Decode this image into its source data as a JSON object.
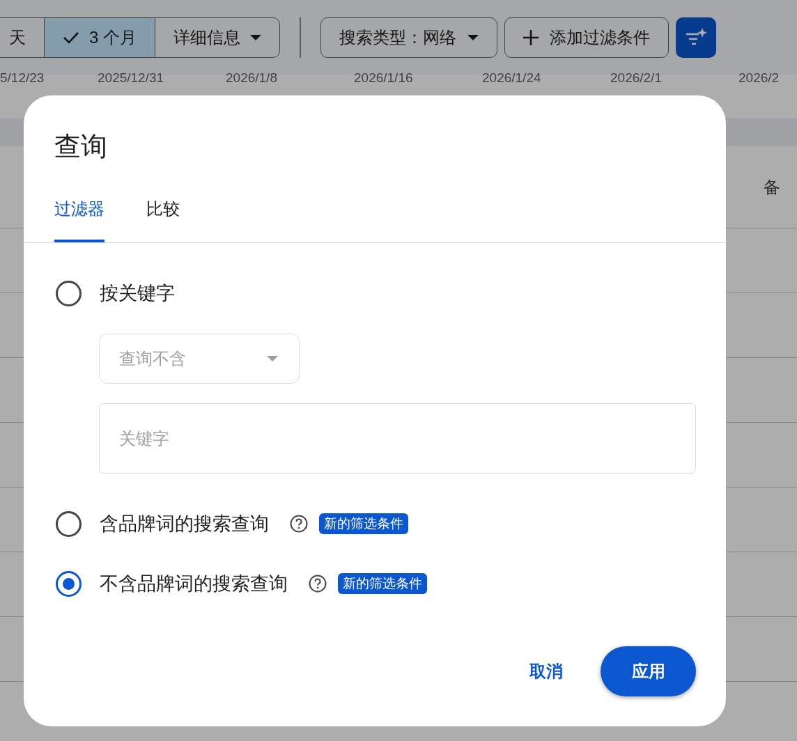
{
  "toolbar": {
    "segments": [
      {
        "kind": "option",
        "label": "天",
        "selected": false
      },
      {
        "kind": "option",
        "label": "3 个月",
        "selected": true
      },
      {
        "kind": "menu",
        "label": "详细信息",
        "selected": false
      }
    ],
    "chips": [
      {
        "kind": "menu",
        "label": "搜索类型：网络"
      },
      {
        "kind": "add",
        "label": "添加过滤条件"
      }
    ]
  },
  "date_axis": [
    "5/12/23",
    "2025/12/31",
    "2026/1/8",
    "2026/1/16",
    "2026/1/24",
    "2026/2/1",
    "2026/2"
  ],
  "table": {
    "header_cell": "备"
  },
  "dialog": {
    "title": "查询",
    "tabs": [
      {
        "label": "过滤器",
        "selected": true
      },
      {
        "label": "比较",
        "selected": false
      }
    ],
    "options": [
      {
        "kind": "keyword",
        "label": "按关键字",
        "selected": false,
        "operator": {
          "value": "查询不含",
          "disabled": true
        },
        "keyword": {
          "placeholder": "关键字"
        }
      },
      {
        "kind": "brand",
        "label": "含品牌词的搜索查询",
        "selected": false,
        "badge": "新的筛选条件"
      },
      {
        "kind": "brand",
        "label": "不含品牌词的搜索查询",
        "selected": true,
        "badge": "新的筛选条件"
      }
    ],
    "buttons": [
      {
        "kind": "text",
        "label": "取消"
      },
      {
        "kind": "filled",
        "label": "应用"
      }
    ]
  }
}
